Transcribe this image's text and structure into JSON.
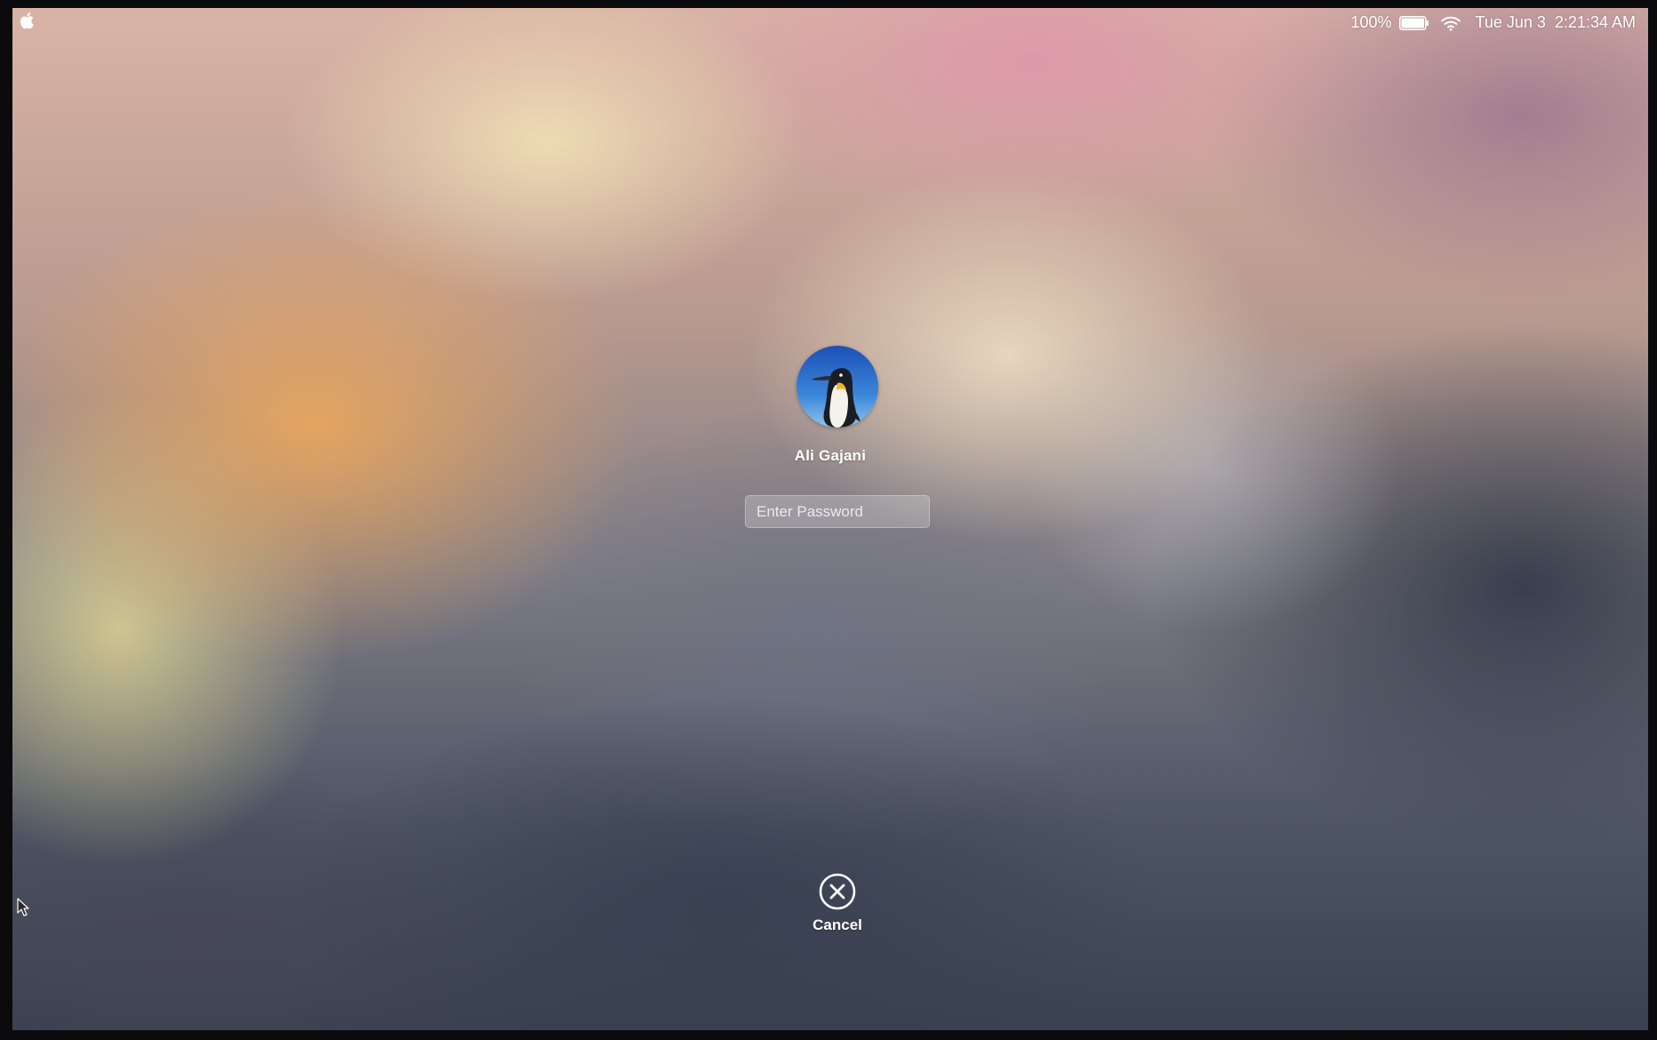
{
  "menubar": {
    "battery_percent": "100%",
    "battery_level": 1.0,
    "date": "Tue Jun 3",
    "time": "2:21:34 AM",
    "icons": [
      "apple-icon",
      "battery-icon",
      "wifi-icon"
    ]
  },
  "login": {
    "user_name": "Ali Gajani",
    "avatar": "penguin-avatar",
    "password_placeholder": "Enter Password",
    "password_value": ""
  },
  "cancel": {
    "label": "Cancel",
    "icon": "close-circle-icon"
  },
  "colors": {
    "text": "#ffffff",
    "field_background": "rgba(255,255,255,0.22)"
  }
}
